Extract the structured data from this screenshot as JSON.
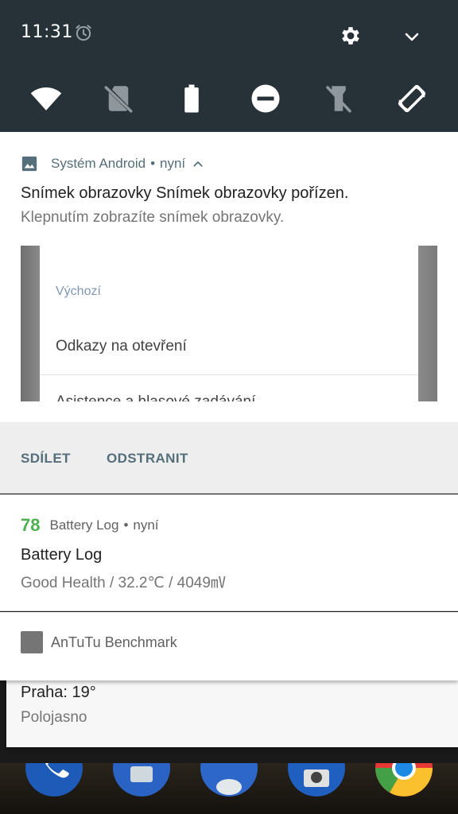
{
  "status_bar": {
    "time": "11:31",
    "icons": [
      "alarm-icon",
      "settings-gear-icon",
      "expand-chevron-icon"
    ]
  },
  "quick_settings": {
    "tiles": [
      "wifi-icon",
      "no-sim-icon",
      "battery-icon",
      "do-not-disturb-icon",
      "flashlight-off-icon",
      "auto-rotate-icon"
    ],
    "background_color": "#263238"
  },
  "notifications": {
    "screenshot": {
      "app": "Systém Android",
      "separator": "•",
      "time": "nyní",
      "title": "Snímek obrazovky Snímek obrazovky pořízen.",
      "text": "Klepnutím zobrazíte snímek obrazovky.",
      "preview": {
        "section": "Výchozí",
        "item1": "Odkazy na otevření",
        "item2": "Asistence a hlasové zadávání"
      },
      "actions": {
        "share": "SDÍLET",
        "delete": "ODSTRANIT"
      },
      "accent_color": "#546e7a"
    },
    "battery": {
      "badge": "78",
      "app": "Battery Log",
      "separator": "•",
      "time": "nyní",
      "title": "Battery Log",
      "text": "Good Health / 32.2℃ / 4049㎷",
      "badge_color": "#4caf50"
    },
    "antutu": {
      "app": "AnTuTu Benchmark"
    },
    "weather": {
      "title": "Praha: 19°",
      "text": "Polojasno"
    }
  },
  "dock": {
    "apps": [
      "phone-icon",
      "messages-icon",
      "contacts-icon",
      "camera-icon",
      "chrome-icon"
    ]
  }
}
